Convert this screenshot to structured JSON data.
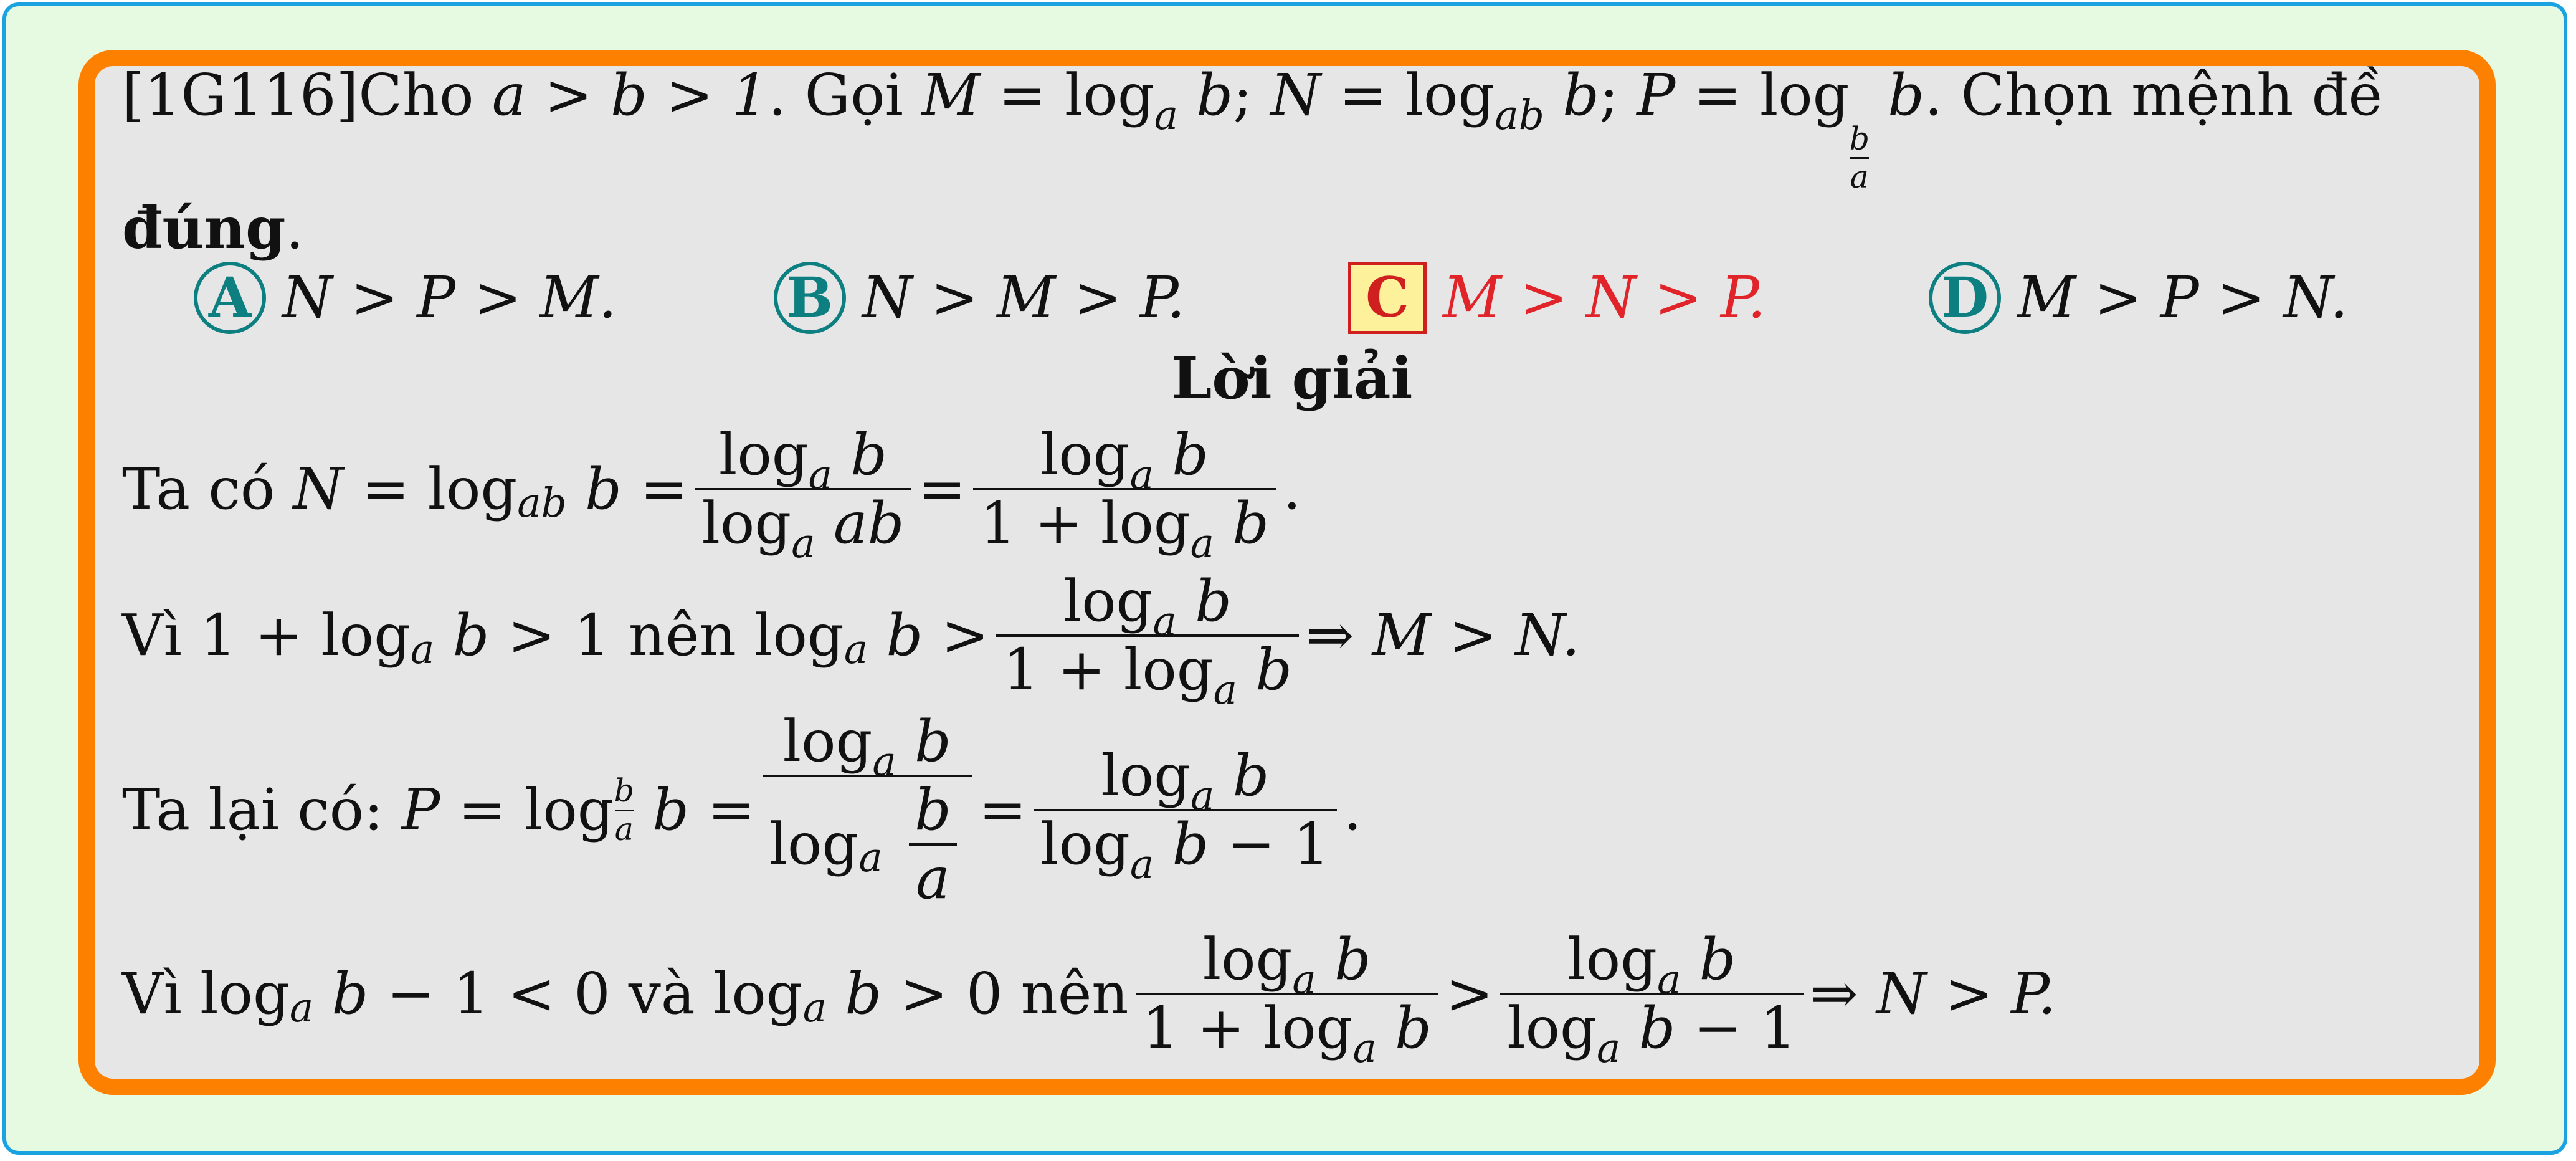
{
  "question": {
    "id": "[1G116]",
    "intro": "Cho",
    "cond": "a > b > 1",
    "goi": ". Gọi",
    "M_def_lhs": "M",
    "N_def_lhs": "N",
    "P_def_lhs": "P",
    "eq": "=",
    "log": "log",
    "sub_a": "a",
    "sub_ab": "ab",
    "var_b": "b",
    "semicolon": ";",
    "frac_b": "b",
    "frac_a": "a",
    "tail": ". Chọn mệnh đề",
    "bold_word": "đúng",
    "period": "."
  },
  "choices": [
    {
      "letter": "A",
      "text": "N > P > M.",
      "correct": false
    },
    {
      "letter": "B",
      "text": "N > M > P.",
      "correct": false
    },
    {
      "letter": "C",
      "text": "M > N > P.",
      "correct": true
    },
    {
      "letter": "D",
      "text": "M > P > N.",
      "correct": false
    }
  ],
  "solution": {
    "heading": "Lời giải",
    "line1_prefix": "Ta có",
    "line2_prefix": "Vì",
    "line2_mid": "nên",
    "line3_prefix": "Ta lại có:",
    "line4_prefix": "Vì",
    "line4_and": "và",
    "line4_mid": "nên",
    "one": "1",
    "zero": "0",
    "implies": "⇒",
    "concl_MN": "M > N.",
    "concl_NP": "N > P."
  },
  "colors": {
    "outer_bg": "#e6fae1",
    "outer_border": "#1aa3e0",
    "inner_bg": "#e6e6e6",
    "inner_border": "#fe8000",
    "choice_circle": "#0e7f80",
    "correct": "#e0242a",
    "correct_box_bg": "#fdf19b"
  }
}
